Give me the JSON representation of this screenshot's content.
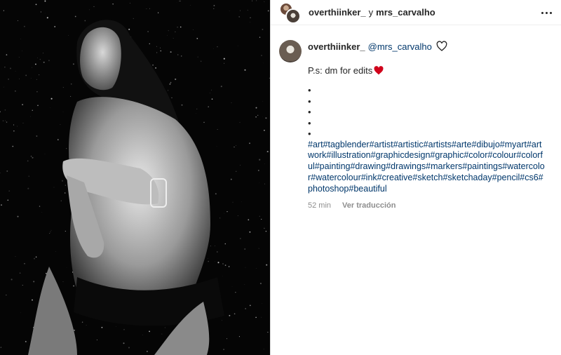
{
  "header": {
    "user1": "overthiinker_",
    "separator": "y",
    "user2": "mrs_carvalho"
  },
  "comment": {
    "username": "overthiinker_",
    "mention": "@mrs_carvalho",
    "ps_text": "P.s: dm for edits",
    "bullets": [
      "•",
      "•",
      "•",
      "•",
      "•"
    ],
    "hashtags": "#art#tagblender#artist#artistic#artists#arte#dibujo#myart#artwork#illustration#graphicdesign#graphic#color#colour#colorful#painting#drawing#drawings#markers#paintings#watercolor#watercolour#ink#creative#sketch#sketchaday#pencil#cs6#photoshop#beautiful",
    "time": "52 min",
    "translate_label": "Ver traducción"
  },
  "icons": {
    "more": "more-horizontal-icon",
    "heart": "heart-outline-icon",
    "emoji": "red-heart-emoji"
  },
  "colors": {
    "link": "#00376b",
    "text": "#262626",
    "muted": "#8e8e8e",
    "emoji_red": "#d0021b"
  }
}
